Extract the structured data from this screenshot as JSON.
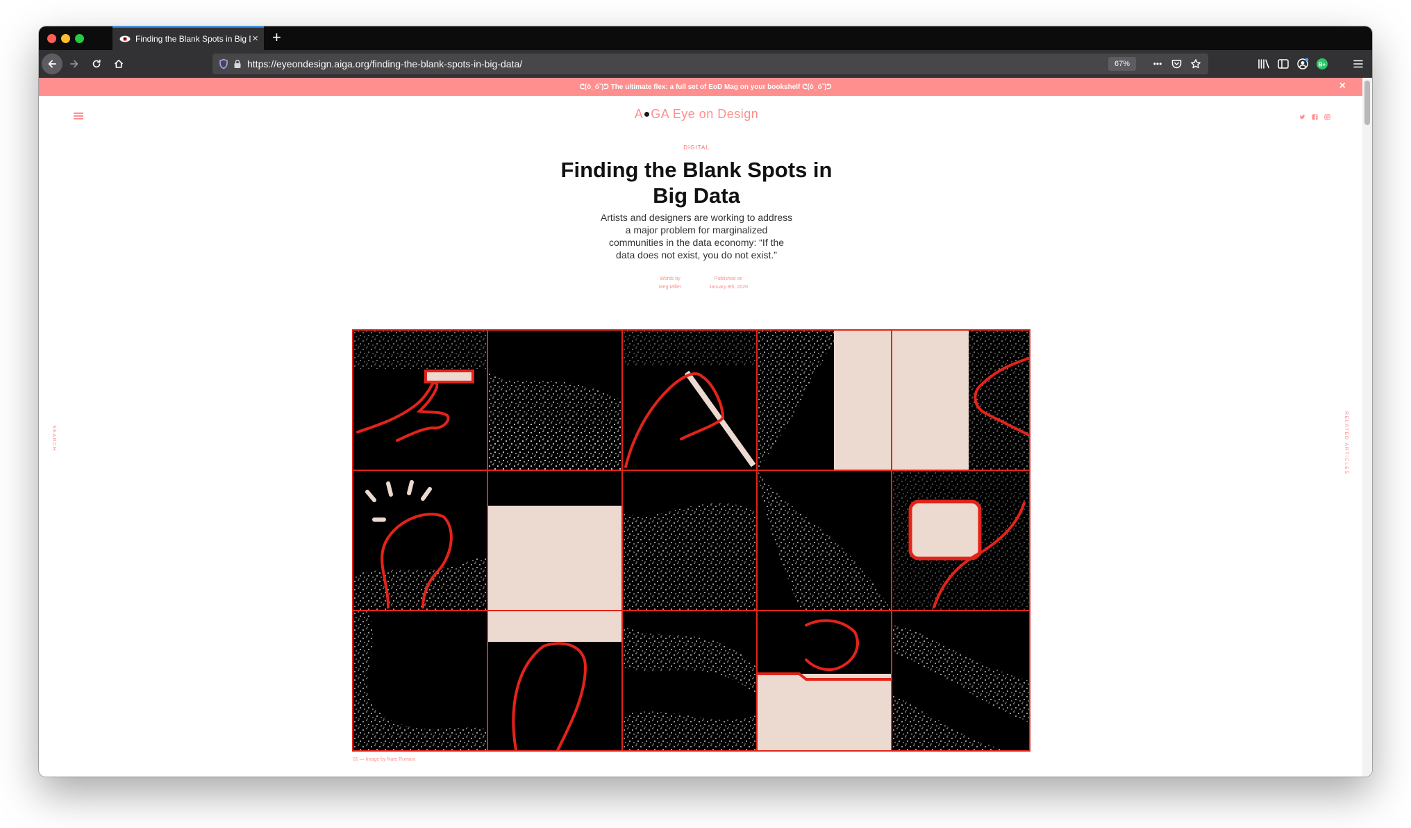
{
  "browser": {
    "tab_title": "Finding the Blank Spots in Big Data",
    "new_tab_label": "+",
    "tab_close_label": "×",
    "url": "https://eyeondesign.aiga.org/finding-the-blank-spots-in-big-data/",
    "zoom_level": "67%",
    "page_actions_label": "•••",
    "profile_badge": "B+"
  },
  "banner": {
    "text": "ᕦ(ò_óˇ)ᕤ The ultimate flex: a full set of EoD Mag on your bookshelf ᕦ(ò_óˇ)ᕤ",
    "close_label": "×"
  },
  "site": {
    "logo_a": "A",
    "logo_ga": "GA",
    "logo_eod": "Eye on Design",
    "search_label": "SEARCH",
    "related_label": "RELATED ARTICLES"
  },
  "article": {
    "category": "DIGITAL",
    "title": "Finding the Blank Spots in Big Data",
    "standfirst": "Artists and designers are working to address a major problem for marginalized communities in the data economy: “If the data does not exist, you do not exist.”",
    "words_by_label": "Words by",
    "author": "Meg Miller",
    "published_label": "Published on",
    "published_date": "January 8th, 2020",
    "image_caption": "01 — Image by Nate Romani"
  },
  "colors": {
    "accent": "#ff8e8e",
    "hero_red": "#e3231a",
    "paper": "#ecd9cf",
    "browser_dark": "#0c0c0d",
    "browser_toolbar": "#323234"
  }
}
